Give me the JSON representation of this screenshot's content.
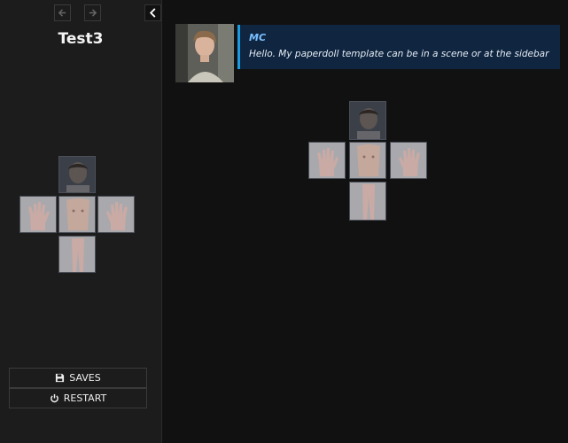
{
  "sidebar": {
    "story_title": "Test3",
    "menu": {
      "saves_label": "SAVES",
      "restart_label": "RESTART"
    },
    "icons": {
      "back": "arrow-left-icon",
      "forward": "arrow-right-icon",
      "toggle": "chevron-left-icon",
      "saves": "floppy-disk-icon",
      "restart": "power-icon"
    }
  },
  "passage": {
    "speaker": "MC",
    "message": "Hello. My paperdoll template can be in a scene or at the sidebar",
    "accent_color": "#1a9be0",
    "box_color": "#0f2540"
  },
  "paperdoll": {
    "slots": [
      "head",
      "left-hand",
      "torso",
      "right-hand",
      "legs"
    ]
  }
}
